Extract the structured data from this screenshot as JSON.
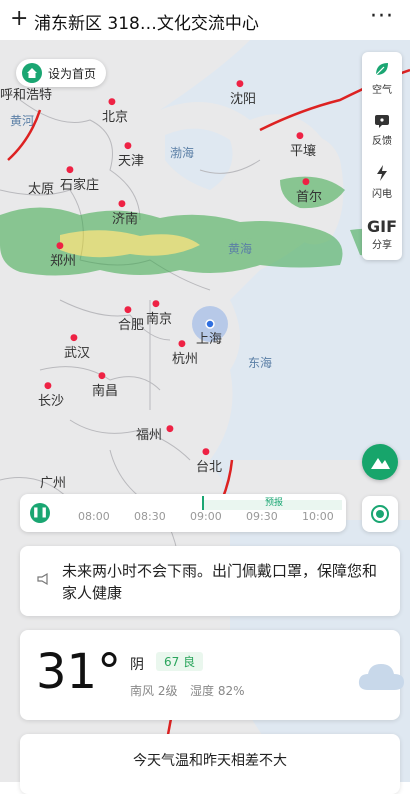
{
  "header": {
    "title": "浦东新区 318…文化交流中心",
    "plus_icon": "+",
    "more_icon": "···"
  },
  "map": {
    "home_button": "设为首页",
    "tools": [
      {
        "label": "空气",
        "icon": "leaf-icon"
      },
      {
        "label": "反馈",
        "icon": "feedback-icon"
      },
      {
        "label": "闪电",
        "icon": "lightning-icon"
      },
      {
        "label": "分享",
        "icon_text": "GIF"
      }
    ],
    "cities": {
      "huhehaote": "呼和浩特",
      "beijing": "北京",
      "tianjin": "天津",
      "shenyang": "沈阳",
      "pingrang": "平壤",
      "shouer": "首尔",
      "taiyuan": "太原",
      "shijiazhuang": "石家庄",
      "jinan": "济南",
      "zhengzhou": "郑州",
      "hefei": "合肥",
      "nanjing": "南京",
      "shanghai": "上海",
      "wuhan": "武汉",
      "hangzhou": "杭州",
      "changsha": "长沙",
      "nanchang": "南昌",
      "fuzhou": "福州",
      "taibei": "台北",
      "guangzhou": "广州"
    },
    "seas": {
      "bohai": "渤海",
      "huanghai": "黄海",
      "donghai": "东海",
      "huanghe": "黄河"
    }
  },
  "timeline": {
    "forecast_label": "预报",
    "times": [
      "08:00",
      "08:30",
      "09:00",
      "09:30",
      "10:00"
    ],
    "current": "09:00"
  },
  "rain_card": {
    "text": "未来两小时不会下雨。出门佩戴口罩，保障您和家人健康"
  },
  "weather_card": {
    "temperature": "31°",
    "condition": "阴",
    "aqi": "67 良",
    "wind": "南风 2级",
    "humidity": "湿度 82%"
  },
  "compare_card": {
    "text": "今天气温和昨天相差不大"
  },
  "colors": {
    "accent": "#1aa672",
    "rain": "#3aa84a",
    "border": "#d22"
  }
}
